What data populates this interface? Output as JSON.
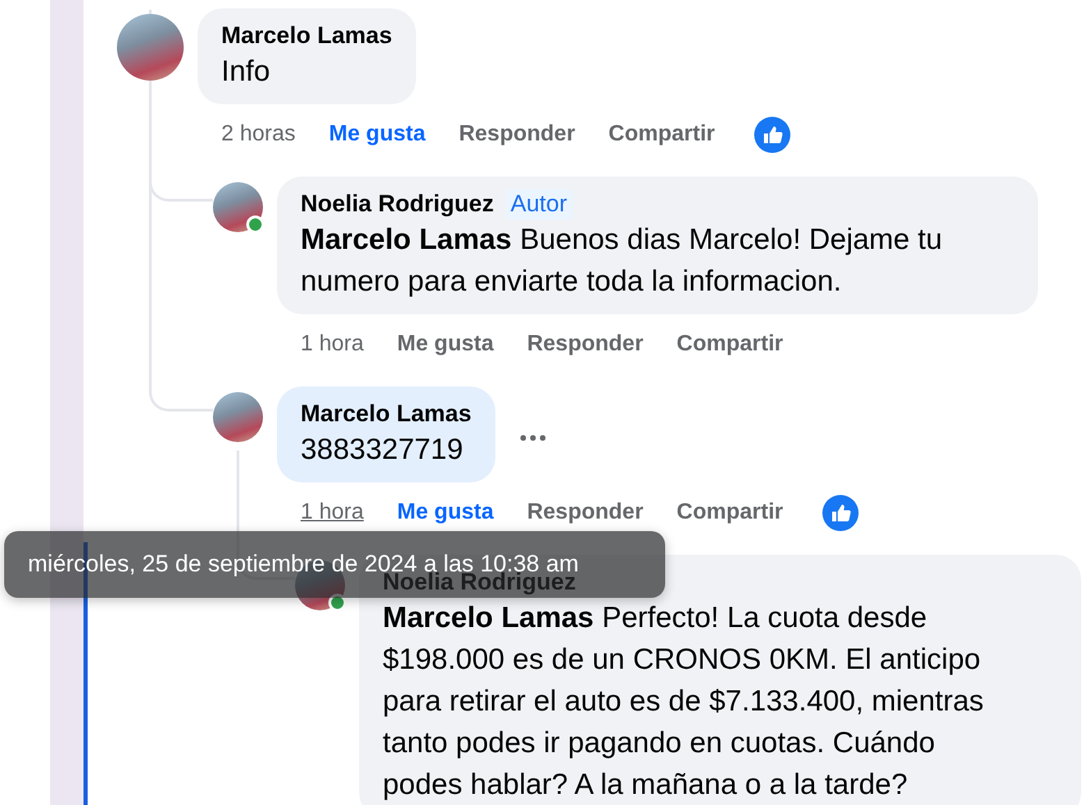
{
  "comments": [
    {
      "author": "Marcelo Lamas",
      "text": "Info",
      "highlighted": false,
      "time": "2 horas",
      "time_hovered": false,
      "like_label": "Me gusta",
      "liked": true,
      "reply_label": "Responder",
      "share_label": "Compartir",
      "reacted": true,
      "children": [
        {
          "author": "Noelia Rodriguez",
          "badge": "Autor",
          "text": "**Marcelo Lamas** Buenos dias Marcelo! Dejame tu numero para enviarte toda la informacion.",
          "highlighted": false,
          "online": true,
          "time": "1 hora",
          "time_hovered": false,
          "like_label": "Me gusta",
          "liked": false,
          "reply_label": "Responder",
          "share_label": "Compartir",
          "reacted": false
        },
        {
          "author": "Marcelo Lamas",
          "text": "3883327719",
          "highlighted": true,
          "hovered": true,
          "time": "1 hora",
          "time_hovered": true,
          "like_label": "Me gusta",
          "liked": true,
          "reply_label": "Responder",
          "share_label": "Compartir",
          "reacted": true,
          "children": [
            {
              "author": "Noelia Rodriguez",
              "text": "**Marcelo Lamas** Perfecto! La cuota desde $198.000 es de un CRONOS 0KM. El anticipo para retirar el auto es de $7.133.400, mientras tanto podes ir pagando en cuotas. Cuándo podes hablar? A la mañana o a la tarde?",
              "highlighted": false,
              "online": true
            }
          ]
        }
      ]
    }
  ],
  "tooltip": {
    "text": "miércoles, 25 de septiembre de 2024 a las 10:38 am"
  }
}
